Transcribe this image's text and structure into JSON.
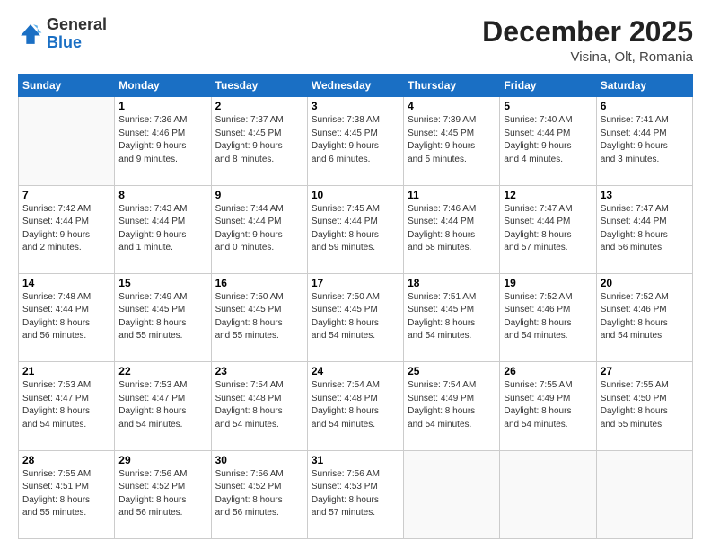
{
  "header": {
    "logo_general": "General",
    "logo_blue": "Blue",
    "month_title": "December 2025",
    "location": "Visina, Olt, Romania"
  },
  "weekdays": [
    "Sunday",
    "Monday",
    "Tuesday",
    "Wednesday",
    "Thursday",
    "Friday",
    "Saturday"
  ],
  "weeks": [
    [
      {
        "day": "",
        "info": ""
      },
      {
        "day": "1",
        "info": "Sunrise: 7:36 AM\nSunset: 4:46 PM\nDaylight: 9 hours\nand 9 minutes."
      },
      {
        "day": "2",
        "info": "Sunrise: 7:37 AM\nSunset: 4:45 PM\nDaylight: 9 hours\nand 8 minutes."
      },
      {
        "day": "3",
        "info": "Sunrise: 7:38 AM\nSunset: 4:45 PM\nDaylight: 9 hours\nand 6 minutes."
      },
      {
        "day": "4",
        "info": "Sunrise: 7:39 AM\nSunset: 4:45 PM\nDaylight: 9 hours\nand 5 minutes."
      },
      {
        "day": "5",
        "info": "Sunrise: 7:40 AM\nSunset: 4:44 PM\nDaylight: 9 hours\nand 4 minutes."
      },
      {
        "day": "6",
        "info": "Sunrise: 7:41 AM\nSunset: 4:44 PM\nDaylight: 9 hours\nand 3 minutes."
      }
    ],
    [
      {
        "day": "7",
        "info": "Sunrise: 7:42 AM\nSunset: 4:44 PM\nDaylight: 9 hours\nand 2 minutes."
      },
      {
        "day": "8",
        "info": "Sunrise: 7:43 AM\nSunset: 4:44 PM\nDaylight: 9 hours\nand 1 minute."
      },
      {
        "day": "9",
        "info": "Sunrise: 7:44 AM\nSunset: 4:44 PM\nDaylight: 9 hours\nand 0 minutes."
      },
      {
        "day": "10",
        "info": "Sunrise: 7:45 AM\nSunset: 4:44 PM\nDaylight: 8 hours\nand 59 minutes."
      },
      {
        "day": "11",
        "info": "Sunrise: 7:46 AM\nSunset: 4:44 PM\nDaylight: 8 hours\nand 58 minutes."
      },
      {
        "day": "12",
        "info": "Sunrise: 7:47 AM\nSunset: 4:44 PM\nDaylight: 8 hours\nand 57 minutes."
      },
      {
        "day": "13",
        "info": "Sunrise: 7:47 AM\nSunset: 4:44 PM\nDaylight: 8 hours\nand 56 minutes."
      }
    ],
    [
      {
        "day": "14",
        "info": "Sunrise: 7:48 AM\nSunset: 4:44 PM\nDaylight: 8 hours\nand 56 minutes."
      },
      {
        "day": "15",
        "info": "Sunrise: 7:49 AM\nSunset: 4:45 PM\nDaylight: 8 hours\nand 55 minutes."
      },
      {
        "day": "16",
        "info": "Sunrise: 7:50 AM\nSunset: 4:45 PM\nDaylight: 8 hours\nand 55 minutes."
      },
      {
        "day": "17",
        "info": "Sunrise: 7:50 AM\nSunset: 4:45 PM\nDaylight: 8 hours\nand 54 minutes."
      },
      {
        "day": "18",
        "info": "Sunrise: 7:51 AM\nSunset: 4:45 PM\nDaylight: 8 hours\nand 54 minutes."
      },
      {
        "day": "19",
        "info": "Sunrise: 7:52 AM\nSunset: 4:46 PM\nDaylight: 8 hours\nand 54 minutes."
      },
      {
        "day": "20",
        "info": "Sunrise: 7:52 AM\nSunset: 4:46 PM\nDaylight: 8 hours\nand 54 minutes."
      }
    ],
    [
      {
        "day": "21",
        "info": "Sunrise: 7:53 AM\nSunset: 4:47 PM\nDaylight: 8 hours\nand 54 minutes."
      },
      {
        "day": "22",
        "info": "Sunrise: 7:53 AM\nSunset: 4:47 PM\nDaylight: 8 hours\nand 54 minutes."
      },
      {
        "day": "23",
        "info": "Sunrise: 7:54 AM\nSunset: 4:48 PM\nDaylight: 8 hours\nand 54 minutes."
      },
      {
        "day": "24",
        "info": "Sunrise: 7:54 AM\nSunset: 4:48 PM\nDaylight: 8 hours\nand 54 minutes."
      },
      {
        "day": "25",
        "info": "Sunrise: 7:54 AM\nSunset: 4:49 PM\nDaylight: 8 hours\nand 54 minutes."
      },
      {
        "day": "26",
        "info": "Sunrise: 7:55 AM\nSunset: 4:49 PM\nDaylight: 8 hours\nand 54 minutes."
      },
      {
        "day": "27",
        "info": "Sunrise: 7:55 AM\nSunset: 4:50 PM\nDaylight: 8 hours\nand 55 minutes."
      }
    ],
    [
      {
        "day": "28",
        "info": "Sunrise: 7:55 AM\nSunset: 4:51 PM\nDaylight: 8 hours\nand 55 minutes."
      },
      {
        "day": "29",
        "info": "Sunrise: 7:56 AM\nSunset: 4:52 PM\nDaylight: 8 hours\nand 56 minutes."
      },
      {
        "day": "30",
        "info": "Sunrise: 7:56 AM\nSunset: 4:52 PM\nDaylight: 8 hours\nand 56 minutes."
      },
      {
        "day": "31",
        "info": "Sunrise: 7:56 AM\nSunset: 4:53 PM\nDaylight: 8 hours\nand 57 minutes."
      },
      {
        "day": "",
        "info": ""
      },
      {
        "day": "",
        "info": ""
      },
      {
        "day": "",
        "info": ""
      }
    ]
  ]
}
